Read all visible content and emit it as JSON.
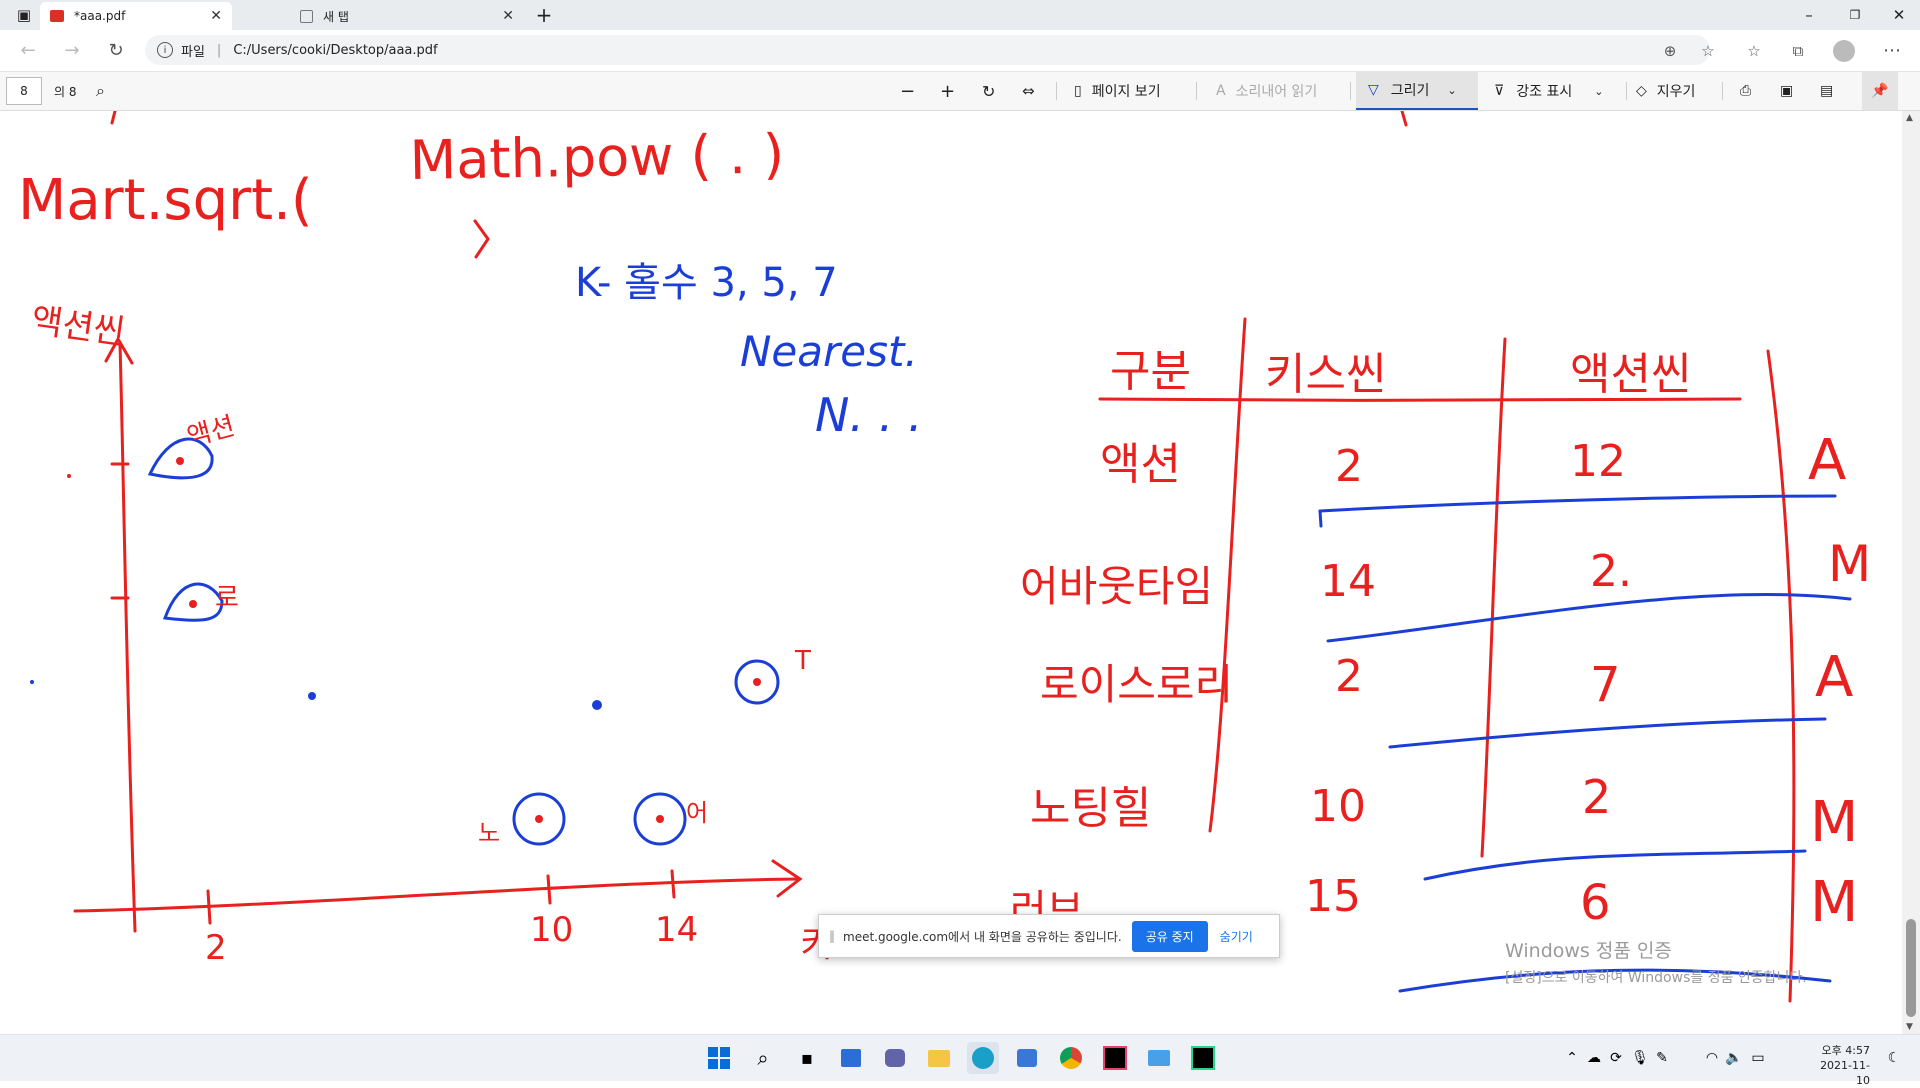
{
  "tabs": [
    {
      "label": "*aaa.pdf",
      "active": true
    },
    {
      "label": "새 탭",
      "active": false
    }
  ],
  "address": {
    "prefix": "파일",
    "url": "C:/Users/cooki/Desktop/aaa.pdf"
  },
  "pdf_toolbar": {
    "page_number": "8",
    "page_total": "의 8",
    "page_view": "페이지 보기",
    "read_aloud": "소리내어 읽기",
    "draw": "그리기",
    "highlight": "강조 표시",
    "erase": "지우기"
  },
  "share_bar": {
    "message": "meet.google.com에서 내 화면을 공유하는 중입니다.",
    "stop_label": "공유 중지",
    "hide_label": "숨기기"
  },
  "watermark": {
    "title": "Windows 정품 인증",
    "subtitle": "[설정]으로 이동하여 Windows를 정품 인증합니다."
  },
  "clock": {
    "time": "오후 4:57",
    "date": "2021-11-10"
  },
  "colors": {
    "ink_red": "#e8201e",
    "ink_blue": "#1b3fd6",
    "share_blue": "#1a73e8"
  },
  "handwriting": {
    "math_pow": "Math.pow ( . )",
    "math_sqrt": "Mart.sqrt.(",
    "k_line": "K- 홀수 3, 5, 7",
    "nearest": "Nearest.",
    "n_dots": "N. . .",
    "y_axis_label": "액션씬",
    "pt_action_label": "액션",
    "pt_romance_label": "로",
    "pt_T_label": "T",
    "pt_10_label": "노",
    "pt_14_label": "어",
    "x_tick_2": "2",
    "x_tick_10": "10",
    "x_tick_14": "14",
    "x_axis_label": "키스",
    "table_headers": [
      "구분",
      "키스씬",
      "액션씬"
    ],
    "table_rows": [
      {
        "name": "액션",
        "kiss": "2",
        "action": "12",
        "class": "A"
      },
      {
        "name": "어바웃타임",
        "kiss": "14",
        "action": "2.",
        "class": "M"
      },
      {
        "name": "로이스로리",
        "kiss": "2",
        "action": "7",
        "class": "A"
      },
      {
        "name": "노팅힐",
        "kiss": "10",
        "action": "2",
        "class": "M"
      },
      {
        "name": "러브",
        "kiss": "15",
        "action": "6",
        "class": "M"
      }
    ]
  }
}
